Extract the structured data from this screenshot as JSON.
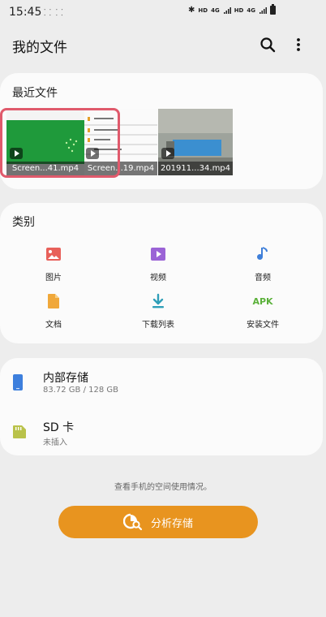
{
  "status_bar": {
    "time": "15:45",
    "screen_icons": "⸬ ⸬",
    "bluetooth": "✱",
    "hd1": "HD",
    "lte": "4G",
    "hd2": "HD",
    "lte2": "4G"
  },
  "app": {
    "title": "我的文件",
    "search_icon": "search-icon",
    "more_icon": "more-vert-icon"
  },
  "recent": {
    "title": "最近文件",
    "items": [
      {
        "name": "Screen...41.mp4"
      },
      {
        "name": "Screen...19.mp4"
      },
      {
        "name": "201911...34.mp4"
      }
    ]
  },
  "categories": {
    "title": "类别",
    "items": [
      {
        "label": "图片",
        "icon": "image-icon",
        "color": "#e8605a"
      },
      {
        "label": "视频",
        "icon": "video-icon",
        "color": "#9b63d6"
      },
      {
        "label": "音频",
        "icon": "music-icon",
        "color": "#3f7fd9"
      },
      {
        "label": "文档",
        "icon": "document-icon",
        "color": "#f0a83a"
      },
      {
        "label": "下载列表",
        "icon": "download-icon",
        "color": "#2f9fb8"
      },
      {
        "label": "安装文件",
        "icon": "apk-icon",
        "color": "#5bb13a",
        "glyph": "APK"
      }
    ]
  },
  "storage": {
    "internal": {
      "name": "内部存储",
      "usage": "83.72 GB / 128 GB"
    },
    "sd": {
      "name": "SD 卡",
      "status": "未插入"
    }
  },
  "analyze": {
    "hint": "查看手机的空间使用情况。",
    "button_label": "分析存储"
  },
  "colors": {
    "accent": "#e8941f",
    "highlight": "#e05a6c",
    "background": "#ededed"
  }
}
